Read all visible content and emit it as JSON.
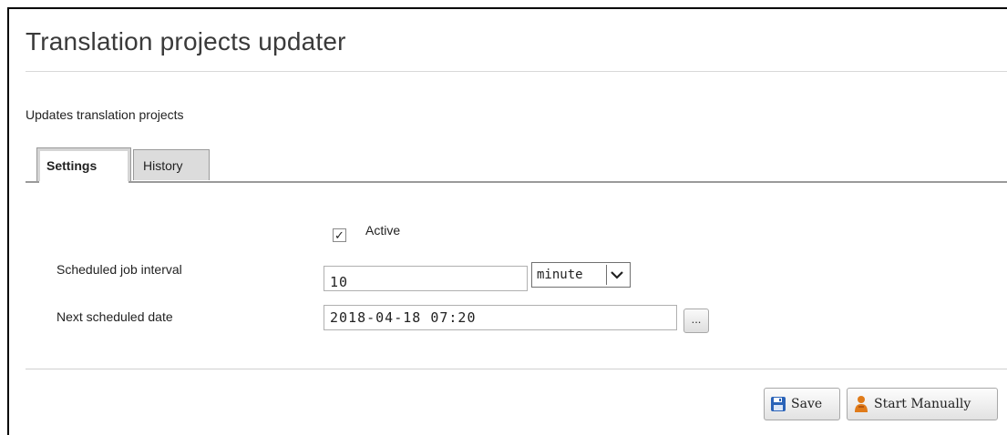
{
  "page": {
    "title": "Translation projects updater",
    "description": "Updates translation projects"
  },
  "tabs": [
    {
      "label": "Settings",
      "selected": true
    },
    {
      "label": "History",
      "selected": false
    }
  ],
  "form": {
    "active": {
      "label": "Active",
      "checked": true,
      "check_glyph": "✓"
    },
    "interval": {
      "label": "Scheduled job interval",
      "value": "10",
      "unit": "minute"
    },
    "next_date": {
      "label": "Next scheduled date",
      "value": "2018-04-18 07:20",
      "picker_label": "..."
    }
  },
  "actions": {
    "save_label": "Save",
    "start_label": "Start Manually"
  },
  "icons": {
    "save": "floppy-disk-icon",
    "start": "user-run-icon"
  },
  "colors": {
    "save_icon": "#2a63b8",
    "start_icon": "#e07b1a"
  }
}
